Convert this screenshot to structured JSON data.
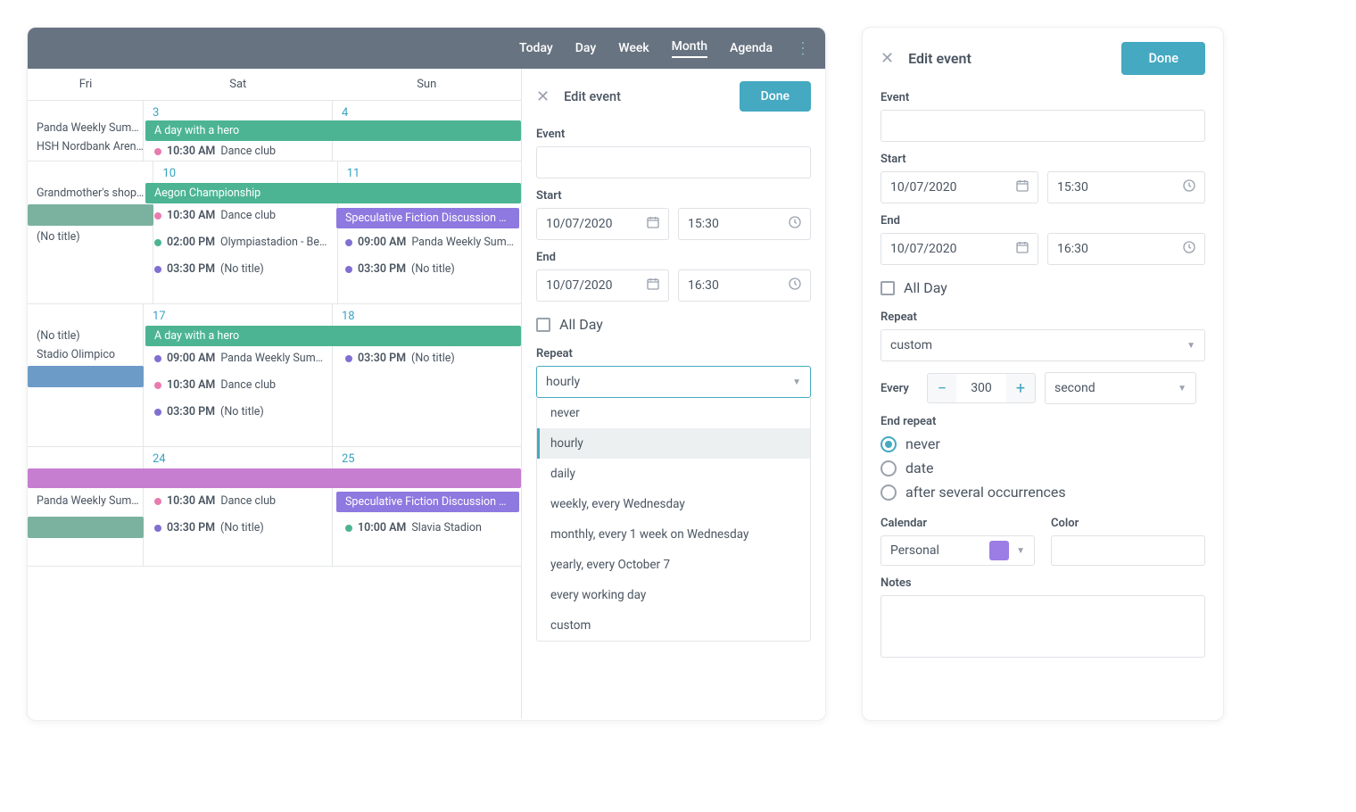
{
  "header": {
    "today": "Today",
    "views": {
      "day": "Day",
      "week": "Week",
      "month": "Month",
      "agenda": "Agenda"
    },
    "active_view": "Month"
  },
  "dow": {
    "fri": "Fri",
    "sat": "Sat",
    "sun": "Sun"
  },
  "dates": {
    "w1": {
      "sat": "3",
      "sun": "4"
    },
    "w2": {
      "sat": "10",
      "sun": "11"
    },
    "w3": {
      "sat": "17",
      "sun": "18"
    },
    "w4": {
      "sat": "24",
      "sun": "25"
    }
  },
  "events": {
    "w0": {
      "fri_panda": "Panda Weekly Sum…",
      "fri_hsh": "HSH Nordbank Aren…",
      "sat_hero": "A day with a hero",
      "sat_dance_t": "10:30 AM",
      "sat_dance": "Dance club"
    },
    "w1": {
      "fri_grand": "Grandmother's shop…",
      "fri_notitle": "(No title)",
      "sat_aegon": "Aegon Championship",
      "sat_dance_t": "10:30 AM",
      "sat_dance": "Dance club",
      "sat_olymp_t": "02:00 PM",
      "sat_olymp": "Olympiastadion - Be…",
      "sat_nt_t": "03:30 PM",
      "sat_nt": "(No title)",
      "sun_spec": "Speculative Fiction Discussion C…",
      "sun_panda_t": "09:00 AM",
      "sun_panda": "Panda Weekly Sum…",
      "sun_nt_t": "03:30 PM",
      "sun_nt": "(No title)"
    },
    "w2": {
      "fri_notitle": "(No title)",
      "fri_stadio": "Stadio Olimpico",
      "sat_hero": "A day with a hero",
      "sat_panda_t": "09:00 AM",
      "sat_panda": "Panda Weekly Sum…",
      "sat_dance_t": "10:30 AM",
      "sat_dance": "Dance club",
      "sat_nt_t": "03:30 PM",
      "sat_nt": "(No title)",
      "sun_nt_t": "03:30 PM",
      "sun_nt": "(No title)"
    },
    "w3": {
      "fri_panda": "Panda Weekly Sum…",
      "sat_dance_t": "10:30 AM",
      "sat_dance": "Dance club",
      "sat_nt_t": "03:30 PM",
      "sat_nt": "(No title)",
      "sun_spec": "Speculative Fiction Discussion C…",
      "sun_slavia_t": "10:00 AM",
      "sun_slavia": "Slavia Stadion"
    }
  },
  "colors": {
    "teal": "#4CB493",
    "pink": "#E87BB0",
    "purple": "#826FD2",
    "blue": "#6C9BC8",
    "green": "#4CB493",
    "violetBar": "#8D79E0",
    "magentaBar": "#C67ED1",
    "mutedTeal": "#7BB29F"
  },
  "form1": {
    "title": "Edit event",
    "done": "Done",
    "event_label": "Event",
    "start_label": "Start",
    "start_date": "10/07/2020",
    "start_time": "15:30",
    "end_label": "End",
    "end_date": "10/07/2020",
    "end_time": "16:30",
    "allday_label": "All Day",
    "repeat_label": "Repeat",
    "repeat_value": "hourly",
    "options": {
      "never": "never",
      "hourly": "hourly",
      "daily": "daily",
      "weekly": "weekly, every Wednesday",
      "monthly": "monthly, every 1 week on Wednesday",
      "yearly": "yearly, every October 7",
      "working": "every working day",
      "custom": "custom"
    }
  },
  "form2": {
    "title": "Edit event",
    "done": "Done",
    "event_label": "Event",
    "start_label": "Start",
    "start_date": "10/07/2020",
    "start_time": "15:30",
    "end_label": "End",
    "end_date": "10/07/2020",
    "end_time": "16:30",
    "allday_label": "All Day",
    "repeat_label": "Repeat",
    "repeat_value": "custom",
    "every_label": "Every",
    "every_value": "300",
    "every_unit": "second",
    "end_repeat_label": "End repeat",
    "radio_never": "never",
    "radio_date": "date",
    "radio_occurrences": "after several occurrences",
    "calendar_label": "Calendar",
    "calendar_value": "Personal",
    "color_label": "Color",
    "notes_label": "Notes"
  }
}
